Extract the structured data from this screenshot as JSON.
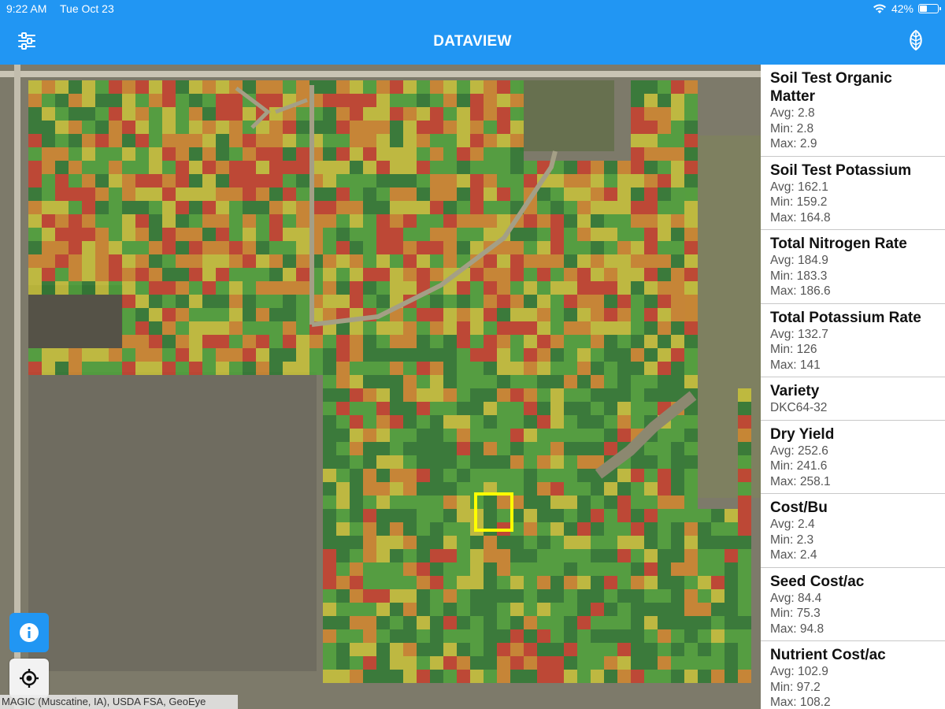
{
  "status_bar": {
    "time": "9:22 AM",
    "date": "Tue Oct 23",
    "battery": "42%",
    "battery_level": 0.42
  },
  "app_bar": {
    "title": "DATAVIEW",
    "left_icon": "sliders-icon",
    "right_icon": "leaf-logo-icon"
  },
  "map": {
    "attribution": "MAGIC (Muscatine, IA), USDA FSA, GeoEye",
    "info_icon": "info-icon",
    "locate_icon": "crosshair-icon",
    "colors": {
      "red": "#c8402d",
      "orange": "#d2872e",
      "yellow": "#c9c33a",
      "green": "#4ea33a",
      "dark_green": "#2f7a33",
      "selection": "#ffff00"
    }
  },
  "sidebar": {
    "metrics": [
      {
        "name": "Soil Test Organic Matter",
        "lines": [
          "Avg: 2.8",
          "Min: 2.8",
          "Max: 2.9"
        ]
      },
      {
        "name": "Soil Test Potassium",
        "lines": [
          "Avg: 162.1",
          "Min: 159.2",
          "Max: 164.8"
        ]
      },
      {
        "name": "Total Nitrogen Rate",
        "lines": [
          "Avg: 184.9",
          "Min: 183.3",
          "Max: 186.6"
        ]
      },
      {
        "name": "Total Potassium Rate",
        "lines": [
          "Avg: 132.7",
          "Min: 126",
          "Max: 141"
        ]
      },
      {
        "name": "Variety",
        "lines": [
          "DKC64-32"
        ]
      },
      {
        "name": "Dry Yield",
        "lines": [
          "Avg: 252.6",
          "Min: 241.6",
          "Max: 258.1"
        ]
      },
      {
        "name": "Cost/Bu",
        "lines": [
          "Avg: 2.4",
          "Min: 2.3",
          "Max: 2.4"
        ]
      },
      {
        "name": "Seed Cost/ac",
        "lines": [
          "Avg: 84.4",
          "Min: 75.3",
          "Max: 94.8"
        ]
      },
      {
        "name": "Nutrient Cost/ac",
        "lines": [
          "Avg: 102.9",
          "Min: 97.2",
          "Max: 108.2"
        ]
      }
    ]
  }
}
